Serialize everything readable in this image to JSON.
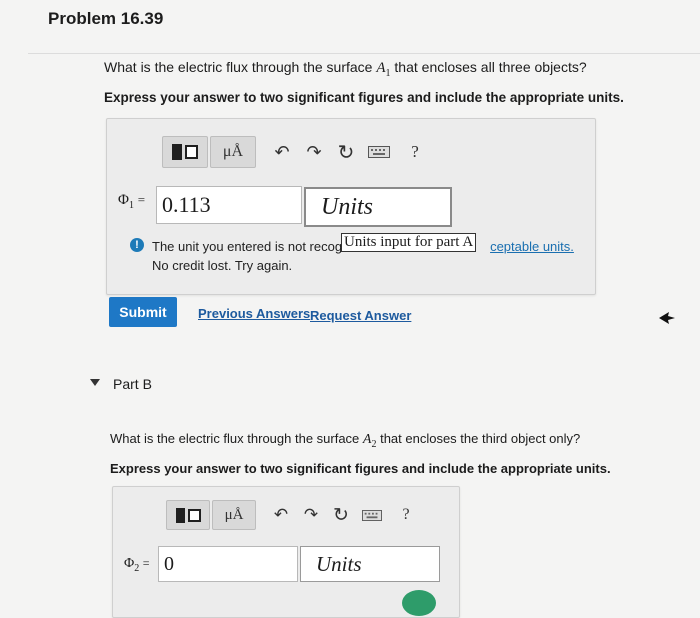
{
  "problem": {
    "title": "Problem 16.39"
  },
  "partA": {
    "question_prefix": "What is the electric flux through the surface ",
    "surface_symbol": "A",
    "surface_sub": "1",
    "question_suffix": " that encloses all three objects?",
    "instruction": "Express your answer to two significant figures and include the appropriate units.",
    "answer_symbol": "Φ",
    "answer_sub": "1",
    "equals": "=",
    "value": "0.113",
    "units_placeholder": "Units",
    "tooltip": "Units input for part A",
    "feedback_part1": "The unit you entered is not recog",
    "feedback_link": "ceptable units.",
    "feedback_line2": "No credit lost. Try again.",
    "submit_label": "Submit",
    "previous_answers_label": "Previous Answers",
    "request_answer_label": "Request Answer"
  },
  "toolbar": {
    "units_label": "μÅ",
    "help_label": "?"
  },
  "partB": {
    "title": "Part B",
    "question_prefix": "What is the electric flux through the surface ",
    "surface_symbol": "A",
    "surface_sub": "2",
    "question_suffix": " that encloses the third object only?",
    "instruction": "Express your answer to two significant figures and include the appropriate units.",
    "answer_symbol": "Φ",
    "answer_sub": "2",
    "equals": "=",
    "value": "0",
    "units_placeholder": "Units"
  },
  "colors": {
    "accent": "#1e78c6",
    "error": "#1a6fb0",
    "link": "#1d5a9e"
  }
}
